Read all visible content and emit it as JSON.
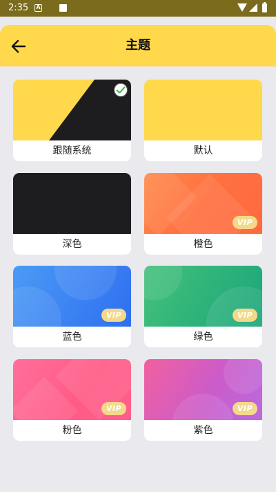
{
  "status_bar": {
    "time": "2:35",
    "icon_a": "A"
  },
  "header": {
    "title": "主题",
    "back_icon": "arrow-left-icon"
  },
  "themes": [
    {
      "label": "跟随系统",
      "selected": true,
      "vip": false
    },
    {
      "label": "默认",
      "selected": false,
      "vip": false
    },
    {
      "label": "深色",
      "selected": false,
      "vip": false
    },
    {
      "label": "橙色",
      "selected": false,
      "vip": true
    },
    {
      "label": "蓝色",
      "selected": false,
      "vip": true
    },
    {
      "label": "绿色",
      "selected": false,
      "vip": true
    },
    {
      "label": "粉色",
      "selected": false,
      "vip": true
    },
    {
      "label": "紫色",
      "selected": false,
      "vip": true
    }
  ],
  "vip_badge": "VIP",
  "colors": {
    "accent": "#ffd84c",
    "dark": "#1d1d1f",
    "orange": "#ff7040",
    "blue": "#3a80f2",
    "green": "#2db27a",
    "pink": "#ff5b86",
    "purple": "#cc5cc9"
  }
}
